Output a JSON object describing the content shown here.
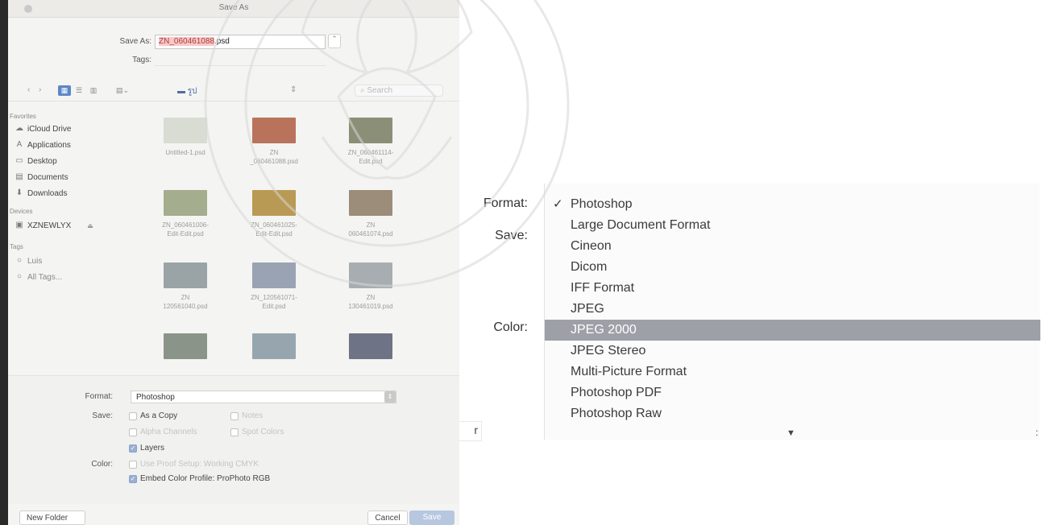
{
  "dialog": {
    "title": "Save As",
    "save_as_label": "Save As:",
    "filename_selected": "ZN_060461088",
    "filename_ext": ".psd",
    "tags_label": "Tags:",
    "location": "รูป",
    "search_placeholder": "Search",
    "sidebar": {
      "favorites_heading": "Favorites",
      "favorites": [
        {
          "label": "iCloud Drive",
          "icon": "cloud-icon"
        },
        {
          "label": "Applications",
          "icon": "applications-icon"
        },
        {
          "label": "Desktop",
          "icon": "desktop-icon"
        },
        {
          "label": "Documents",
          "icon": "documents-icon"
        },
        {
          "label": "Downloads",
          "icon": "downloads-icon"
        }
      ],
      "devices_heading": "Devices",
      "devices": [
        {
          "label": "XZNEWLYX",
          "icon": "disk-icon"
        }
      ],
      "tags_heading": "Tags",
      "tags": [
        {
          "label": "Luis"
        },
        {
          "label": "All Tags..."
        }
      ]
    },
    "files": [
      {
        "name": "Untitled-1.psd",
        "color": "#d8dcd3"
      },
      {
        "name": "ZN\n_060461088.psd",
        "color": "#b9735c"
      },
      {
        "name": "ZN_060461114-\nEdit.psd",
        "color": "#8c8f78"
      },
      {
        "name": "ZN_060461006-\nEdit-Edit.psd",
        "color": "#a4ad8e"
      },
      {
        "name": "ZN_060461025-\nEdit-Edit.psd",
        "color": "#b99a55"
      },
      {
        "name": "ZN\n060461074.psd",
        "color": "#9c8c7a"
      },
      {
        "name": "ZN\n120561040.psd",
        "color": "#9aa3a5"
      },
      {
        "name": "ZN_120561071-\nEdit.psd",
        "color": "#9aa3b3"
      },
      {
        "name": "ZN\n130461019.psd",
        "color": "#a7adb0"
      },
      {
        "name": "",
        "color": "#8b9488"
      },
      {
        "name": "",
        "color": "#97a6ae"
      },
      {
        "name": "",
        "color": "#6e7386"
      }
    ],
    "options": {
      "format_label": "Format:",
      "format_value": "Photoshop",
      "save_label": "Save:",
      "as_a_copy": "As a Copy",
      "notes": "Notes",
      "alpha_channels": "Alpha Channels",
      "spot_colors": "Spot Colors",
      "layers": "Layers",
      "color_label": "Color:",
      "use_proof": "Use Proof Setup: Working CMYK",
      "embed_profile": "Embed Color Profile: ProPhoto RGB"
    },
    "new_folder": "New Folder",
    "cancel": "Cancel",
    "save": "Save"
  },
  "zoom": {
    "format_label": "Format:",
    "save_label": "Save:",
    "color_label": "Color:",
    "menu_items": [
      "Photoshop",
      "Large Document Format",
      "Cineon",
      "Dicom",
      "IFF Format",
      "JPEG",
      "JPEG 2000",
      "JPEG Stereo",
      "Multi-Picture Format",
      "Photoshop PDF",
      "Photoshop Raw"
    ],
    "checked_item": "Photoshop",
    "highlighted_item": "JPEG 2000",
    "more_arrow": "▼",
    "edge_char": "r",
    "colon_mark": ":"
  },
  "colors": {
    "highlight": "#9ea0a7",
    "accent": "#5b87c8",
    "selection_red": "#b23a3a"
  }
}
